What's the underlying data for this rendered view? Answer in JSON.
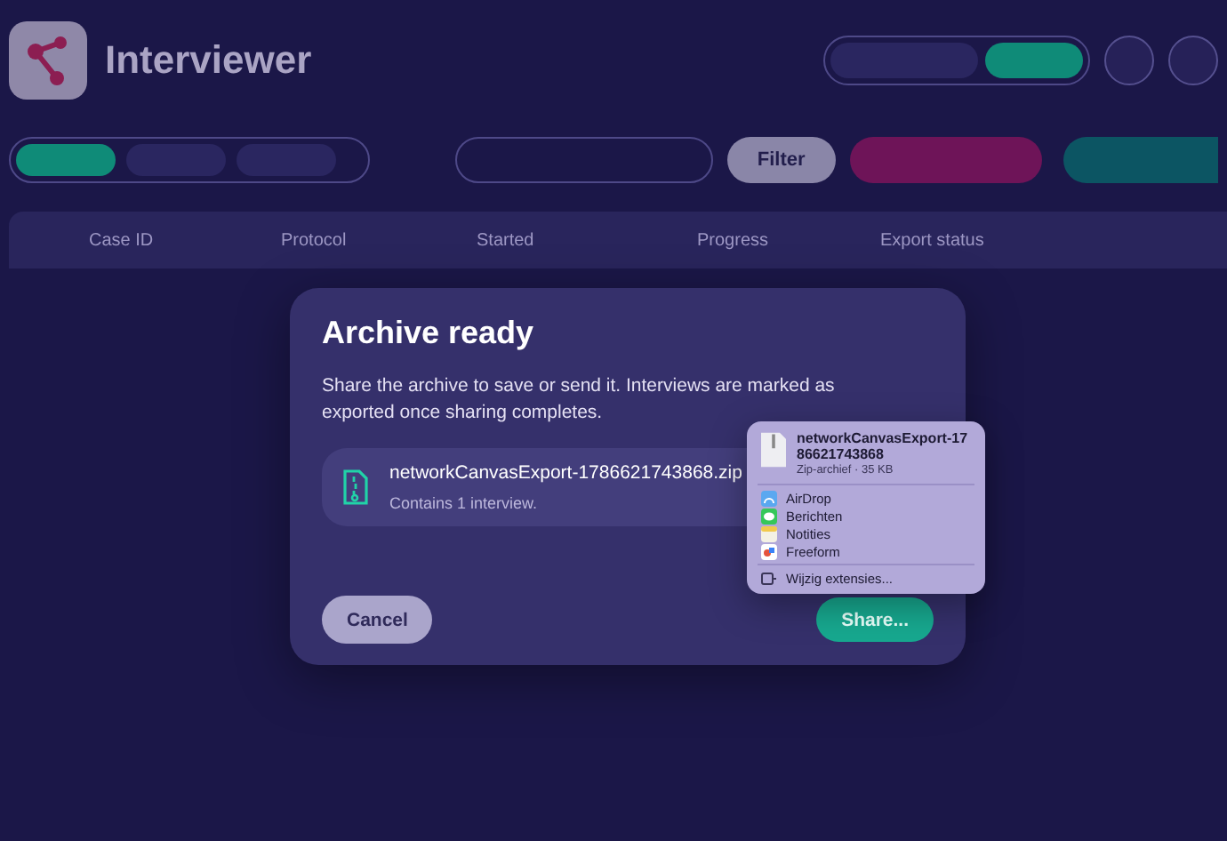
{
  "app": {
    "title": "Interviewer"
  },
  "mode_switch": [
    {
      "selected": false
    },
    {
      "selected": true
    }
  ],
  "status_tabs": [
    {
      "selected": true
    },
    {
      "selected": false
    },
    {
      "selected": false
    }
  ],
  "toolbar": {
    "filter": "Filter"
  },
  "table": {
    "columns": [
      "Case ID",
      "Protocol",
      "Started",
      "Progress",
      "Export status"
    ]
  },
  "dialog": {
    "title": "Archive ready",
    "message": "Share the archive to save or send it. Interviews are marked as exported once sharing completes.",
    "file": {
      "name": "networkCanvasExport-1786621743868.zip",
      "detail": "Contains 1 interview."
    },
    "buttons": [
      {
        "label": "Cancel",
        "kind": "secondary"
      },
      {
        "label": "Share...",
        "kind": "primary"
      }
    ]
  },
  "share_menu": {
    "file_name": "networkCanvasExport-1786621743868",
    "file_info": "Zip-archief · 35 KB",
    "items": [
      {
        "label": "AirDrop",
        "kind": "airdrop"
      },
      {
        "label": "Berichten",
        "kind": "messages"
      },
      {
        "label": "Notities",
        "kind": "notes"
      },
      {
        "label": "Freeform",
        "kind": "freeform"
      }
    ],
    "footer": "Wijzig extensies..."
  }
}
